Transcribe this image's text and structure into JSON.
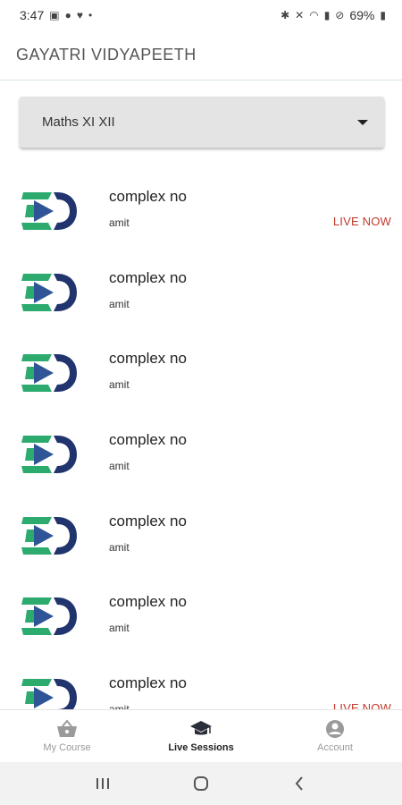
{
  "status_bar": {
    "time": "3:47",
    "battery": "69%",
    "left_icons": [
      "image-icon",
      "account-icon",
      "heart-icon",
      "dot-icon"
    ],
    "right_icons": [
      "bluetooth-icon",
      "mute-icon",
      "wifi-icon",
      "signal-icon",
      "dnd-icon",
      "battery-icon"
    ]
  },
  "header": {
    "title": "GAYATRI VIDYAPEETH"
  },
  "course_select": {
    "selected": "Maths XI XII"
  },
  "sessions": [
    {
      "title": "complex no",
      "author": "amit",
      "badge": "LIVE NOW"
    },
    {
      "title": "complex no",
      "author": "amit",
      "badge": ""
    },
    {
      "title": "complex no",
      "author": "amit",
      "badge": ""
    },
    {
      "title": "complex no",
      "author": "amit",
      "badge": ""
    },
    {
      "title": "complex no",
      "author": "amit",
      "badge": ""
    },
    {
      "title": "complex no",
      "author": "amit",
      "badge": ""
    },
    {
      "title": "complex no",
      "author": "amit",
      "badge": "LIVE NOW"
    }
  ],
  "bottom_nav": {
    "items": [
      {
        "label": "My Course",
        "icon": "basket-icon",
        "active": false
      },
      {
        "label": "Live Sessions",
        "icon": "graduation-cap-icon",
        "active": true
      },
      {
        "label": "Account",
        "icon": "account-circle-icon",
        "active": false
      }
    ]
  },
  "colors": {
    "accent_green": "#2daa6e",
    "accent_navy": "#22346e",
    "live_red": "#c0392b",
    "divider": "#d6e4ea"
  }
}
